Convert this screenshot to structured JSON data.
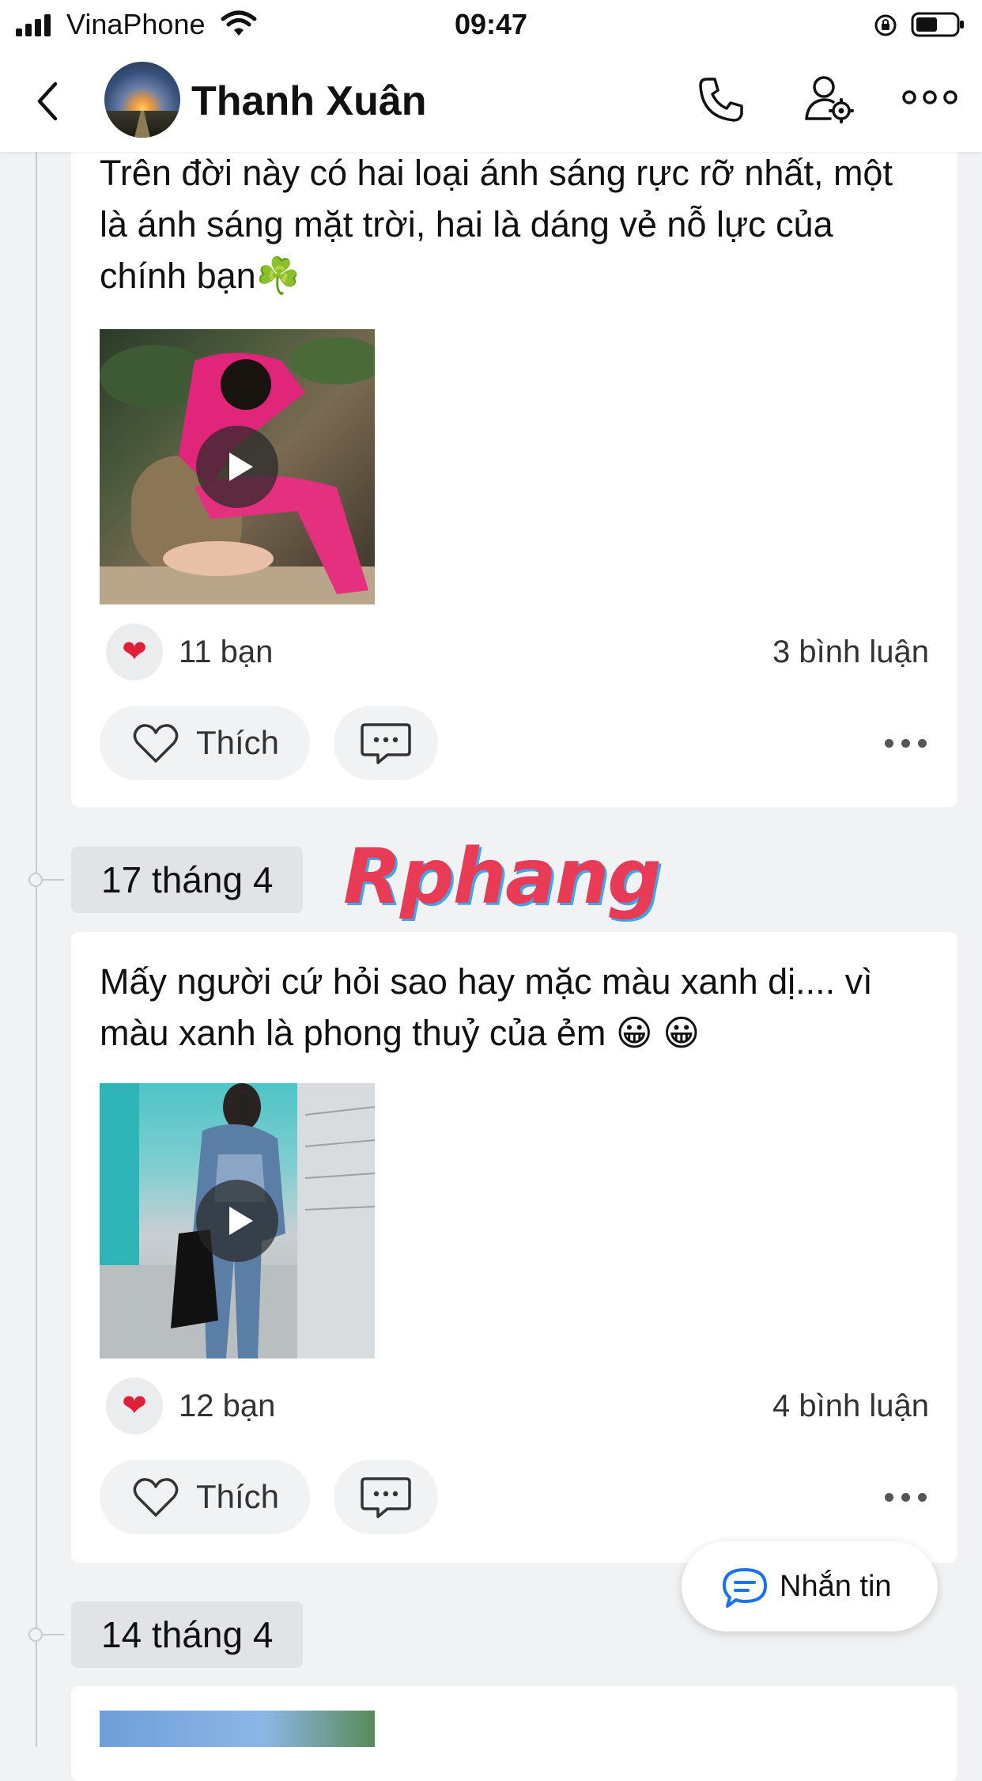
{
  "status_bar": {
    "carrier": "VinaPhone",
    "time": "09:47"
  },
  "header": {
    "profile_name": "Thanh Xuân"
  },
  "timeline": {
    "posts": [
      {
        "text": "Trên đời này có hai loại ánh sáng rực rỡ nhất, một là ánh sáng mặt trời, hai là dáng vẻ nỗ lực của chính bạn☘️",
        "reaction_icon": "heart-icon",
        "reactions": "11 bạn",
        "comments": "3 bình luận",
        "like_label": "Thích"
      },
      {
        "date": "17 tháng 4",
        "text": "Mấy người cứ hỏi sao hay mặc màu xanh dị.... vì màu xanh là phong thuỷ của ẻm 😀 😀",
        "reaction_icon": "heart-icon",
        "reactions": "12 bạn",
        "comments": "4 bình luận",
        "like_label": "Thích"
      },
      {
        "date": "14 tháng 4"
      }
    ]
  },
  "watermark": "Rphang",
  "message_button": {
    "label": "Nhắn tin"
  },
  "colors": {
    "background": "#f1f2f4",
    "heart": "#e0203a",
    "accent_blue": "#1a73e8"
  }
}
